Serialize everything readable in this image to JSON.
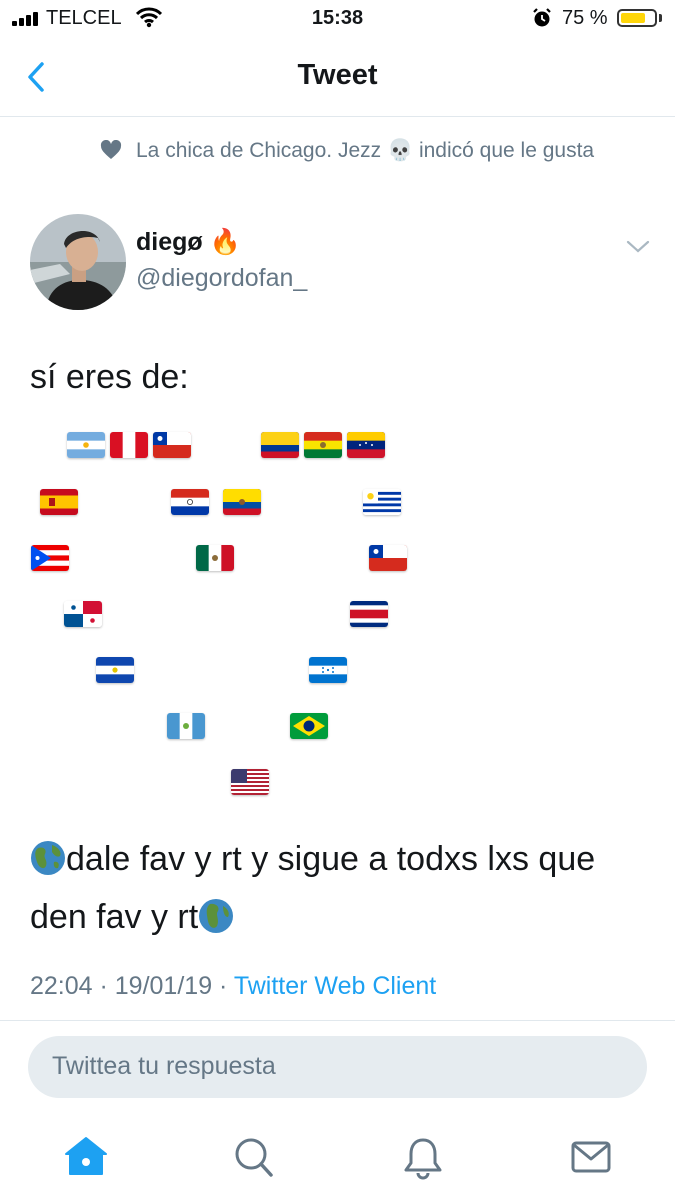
{
  "status_bar": {
    "carrier": "TELCEL",
    "time": "15:38",
    "battery": "75 %",
    "battery_level": 0.75
  },
  "nav": {
    "title": "Tweet",
    "back_icon": "chevron-left-icon"
  },
  "social_context": {
    "icon": "heart-icon",
    "text": "La chica de Chicago. Jezz 💀 indicó que le gusta"
  },
  "author": {
    "name": "diegø 🔥",
    "handle": "@diegordofan_"
  },
  "tweet": {
    "intro": "sí eres de:",
    "flags": [
      "Argentina",
      "Perú",
      "Chile",
      "Colombia",
      "Bolivia",
      "Venezuela",
      "España",
      "Paraguay",
      "Ecuador",
      "Uruguay",
      "Puerto Rico",
      "México",
      "Chile",
      "Panamá",
      "Costa Rica",
      "El Salvador",
      "Honduras",
      "Guatemala",
      "Brasil",
      "Estados Unidos"
    ],
    "cta_line1": "dale fav y rt y sigue a todxs lxs que",
    "cta_line2": "den fav y rt",
    "timestamp": "22:04 · 19/01/19 · ",
    "source": "Twitter Web Client"
  },
  "reply_box": {
    "placeholder": "Twittea tu respuesta"
  },
  "tab_bar": {
    "tabs": [
      "home-icon",
      "search-icon",
      "notifications-icon",
      "messages-icon"
    ],
    "active": "home-icon"
  },
  "colors": {
    "accent": "#1da1f2",
    "muted": "#657786",
    "text": "#14171a"
  }
}
